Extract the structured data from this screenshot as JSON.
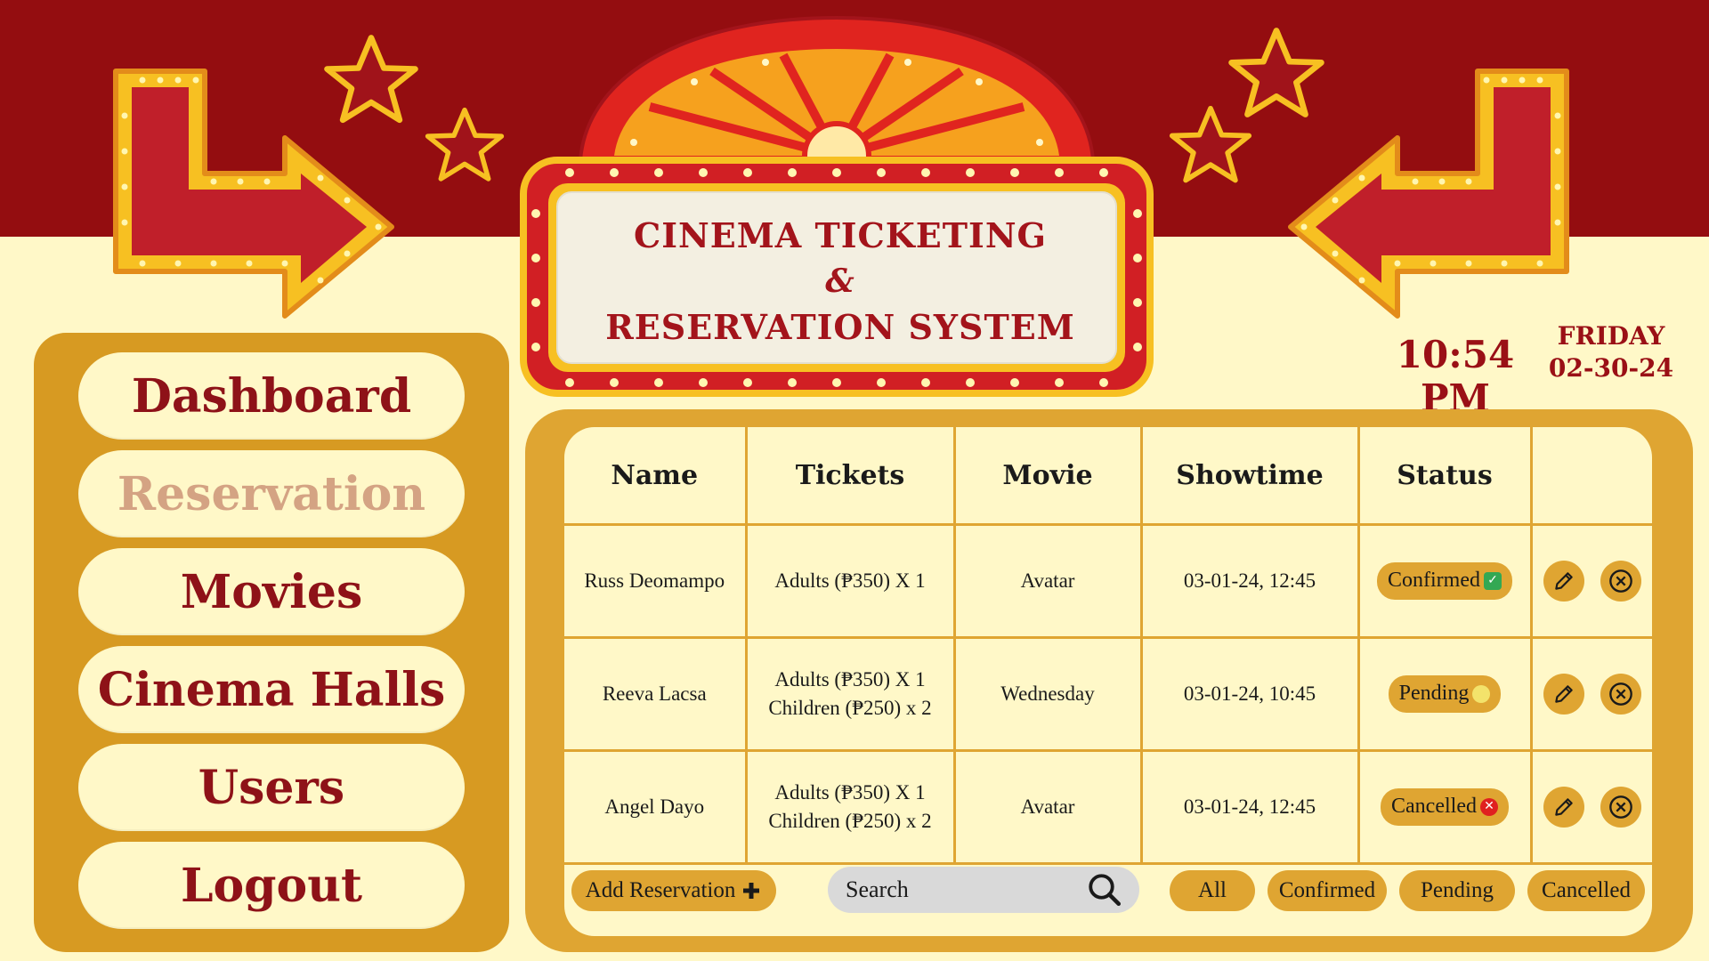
{
  "app": {
    "title_line1": "Cinema Ticketing",
    "title_line2": "&",
    "title_line3": "Reservation System",
    "time": "10:54 PM",
    "day": "FRIDAY",
    "date": "02-30-24"
  },
  "sidebar": {
    "items": [
      {
        "label": "Dashboard"
      },
      {
        "label": "Reservation"
      },
      {
        "label": "Movies"
      },
      {
        "label": "Cinema Halls"
      },
      {
        "label": "Users"
      },
      {
        "label": "Logout"
      }
    ]
  },
  "table": {
    "headers": [
      "Name",
      "Tickets",
      "Movie",
      "Showtime",
      "Status"
    ],
    "rows": [
      {
        "name": "Russ Deomampo",
        "tickets_1": "Adults (₱350) X 1",
        "tickets_2": "",
        "movie": "Avatar",
        "showtime": "03-01-24, 12:45",
        "status": "Confirmed"
      },
      {
        "name": "Reeva Lacsa",
        "tickets_1": "Adults (₱350) X 1",
        "tickets_2": "Children (₱250) x 2",
        "movie": "Wednesday",
        "showtime": "03-01-24, 10:45",
        "status": "Pending"
      },
      {
        "name": "Angel Dayo",
        "tickets_1": "Adults (₱350) X 1",
        "tickets_2": "Children (₱250) x 2",
        "movie": "Avatar",
        "showtime": "03-01-24, 12:45",
        "status": "Cancelled"
      }
    ]
  },
  "toolbar": {
    "add_label": "Add Reservation",
    "search_placeholder": "Search",
    "filters": [
      "All",
      "Confirmed",
      "Pending",
      "Cancelled"
    ]
  },
  "colors": {
    "band": "#940d10",
    "background": "#fff8c8",
    "gold": "#dfa532",
    "crimson": "#9a1016",
    "active_nav": "#d4a383"
  },
  "icons": [
    "star-icon",
    "arrow-icon",
    "pencil-icon",
    "close-circle-icon",
    "search-icon",
    "plus-icon",
    "check-icon"
  ]
}
